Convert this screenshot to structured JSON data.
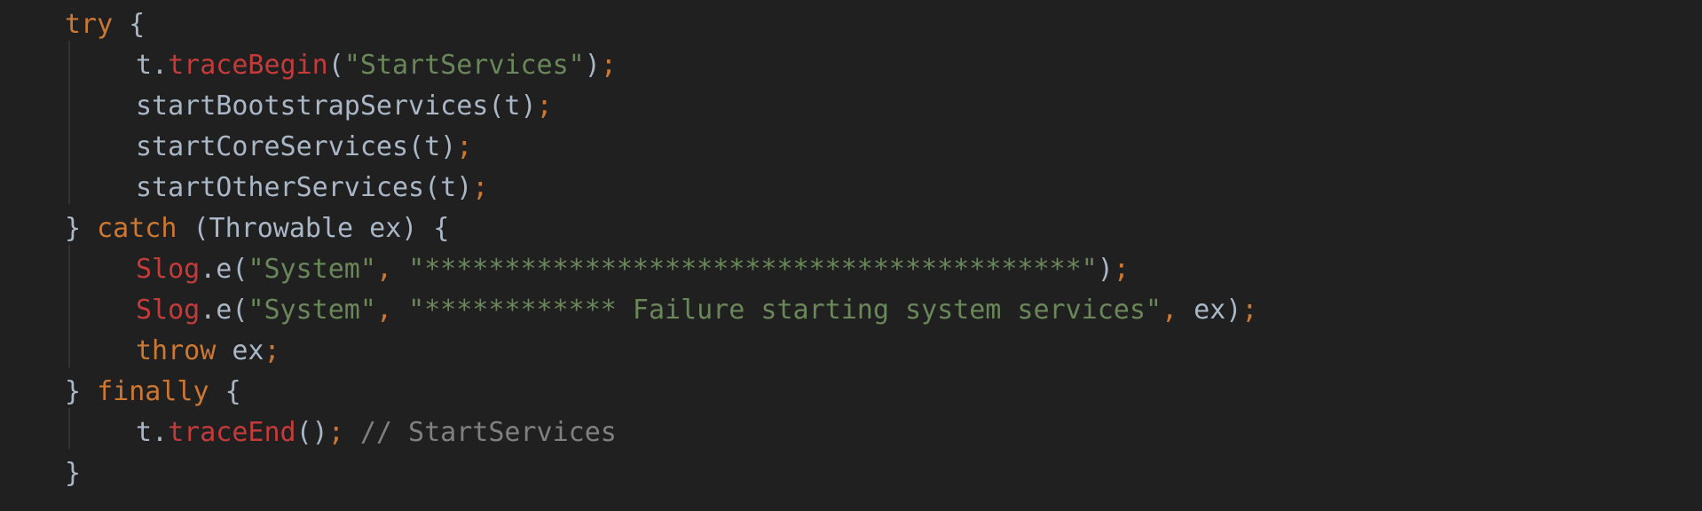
{
  "code": {
    "l1": {
      "kw_try": "try",
      "brace": " {"
    },
    "l2": {
      "obj": "t.",
      "method": "traceBegin",
      "open": "(",
      "str": "\"StartServices\"",
      "close": ")",
      "semi": ";"
    },
    "l3": {
      "call": "startBootstrapServices(t)",
      "semi": ";"
    },
    "l4": {
      "call": "startCoreServices(t)",
      "semi": ";"
    },
    "l5": {
      "call": "startOtherServices(t)",
      "semi": ";"
    },
    "l6": {
      "close": "} ",
      "kw_catch": "catch",
      "params": " (Throwable ex) {"
    },
    "l7": {
      "cls": "Slog",
      "method": ".e(",
      "str1": "\"System\"",
      "comma": ", ",
      "str2": "\"*****************************************\"",
      "close": ")",
      "semi": ";"
    },
    "l8": {
      "cls": "Slog",
      "method": ".e(",
      "str1": "\"System\"",
      "comma1": ", ",
      "str2": "\"************ Failure starting system services\"",
      "comma2": ", ",
      "arg": "ex",
      "close": ")",
      "semi": ";"
    },
    "l9": {
      "kw_throw": "throw",
      "arg": " ex",
      "semi": ";"
    },
    "l10": {
      "close": "} ",
      "kw_finally": "finally",
      "brace": " {"
    },
    "l11": {
      "obj": "t.",
      "method": "traceEnd",
      "parens": "()",
      "semi": ";",
      "comment": " // StartServices"
    },
    "l12": {
      "close": "}"
    }
  }
}
